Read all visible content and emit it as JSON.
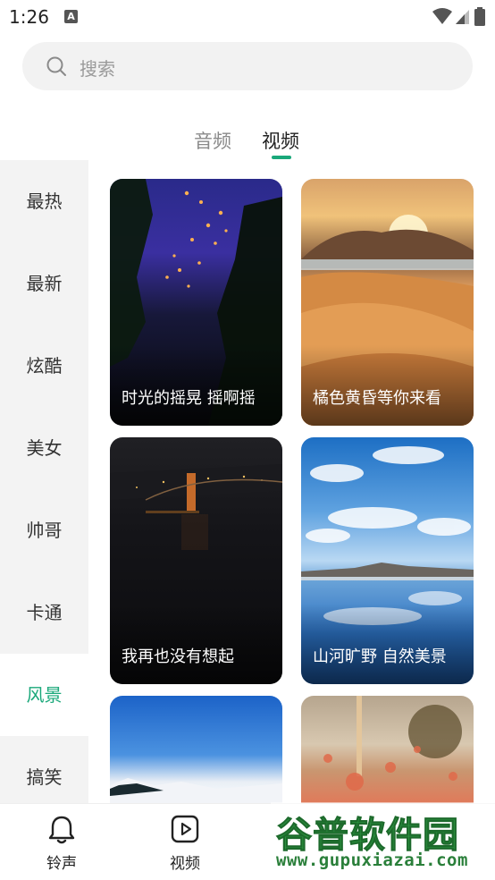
{
  "status_bar": {
    "time": "1:26",
    "notification_badge": "A"
  },
  "search": {
    "placeholder": "搜索"
  },
  "tabs": [
    {
      "label": "音频"
    },
    {
      "label": "视频",
      "active": true
    }
  ],
  "sidebar": {
    "items": [
      {
        "label": "最热"
      },
      {
        "label": "最新"
      },
      {
        "label": "炫酷"
      },
      {
        "label": "美女"
      },
      {
        "label": "帅哥"
      },
      {
        "label": "卡通"
      },
      {
        "label": "风景",
        "active": true
      },
      {
        "label": "搞笑"
      }
    ]
  },
  "videos": [
    {
      "title": "时光的摇晃 摇啊摇"
    },
    {
      "title": "橘色黄昏等你来看"
    },
    {
      "title": "我再也没有想起"
    },
    {
      "title": "山河旷野 自然美景"
    },
    {
      "title": ""
    },
    {
      "title": ""
    }
  ],
  "bottom_nav": [
    {
      "label": "铃声",
      "icon": "bell-icon"
    },
    {
      "label": "视频",
      "icon": "play-icon"
    }
  ],
  "watermark": {
    "title": "谷普软件园",
    "url": "www.gupuxiazai.com"
  },
  "colors": {
    "accent": "#1aa87a",
    "sidebar_bg": "#f3f3f3",
    "search_bg": "#f2f2f2"
  }
}
